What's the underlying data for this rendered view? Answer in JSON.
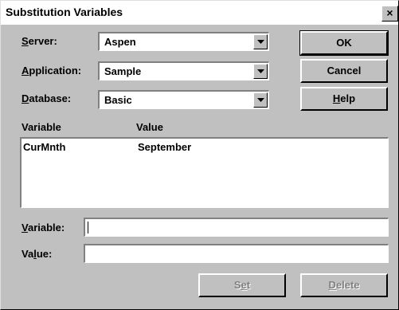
{
  "window": {
    "title": "Substitution Variables",
    "close_glyph": "×"
  },
  "form": {
    "server": {
      "label_accel": "S",
      "label_rest": "erver:",
      "value": "Aspen"
    },
    "application": {
      "label_accel": "A",
      "label_rest": "pplication:",
      "value": "Sample"
    },
    "database": {
      "label_accel": "D",
      "label_rest": "atabase:",
      "value": "Basic"
    }
  },
  "buttons": {
    "ok": "OK",
    "cancel": "Cancel",
    "help_accel": "H",
    "help_rest": "elp",
    "set_pre": "S",
    "set_accel": "e",
    "set_post": "t",
    "delete_accel": "D",
    "delete_rest": "elete"
  },
  "list": {
    "headers": [
      "Variable",
      "Value"
    ],
    "rows": [
      {
        "variable": "CurMnth",
        "value": "September"
      }
    ]
  },
  "edit": {
    "variable": {
      "label_accel": "V",
      "label_rest": "ariable:",
      "value": ""
    },
    "value": {
      "label_pre": "Va",
      "label_accel": "l",
      "label_post": "ue:",
      "value": ""
    }
  },
  "icons": {
    "dropdown": "chevron-down-icon",
    "close": "close-icon"
  }
}
